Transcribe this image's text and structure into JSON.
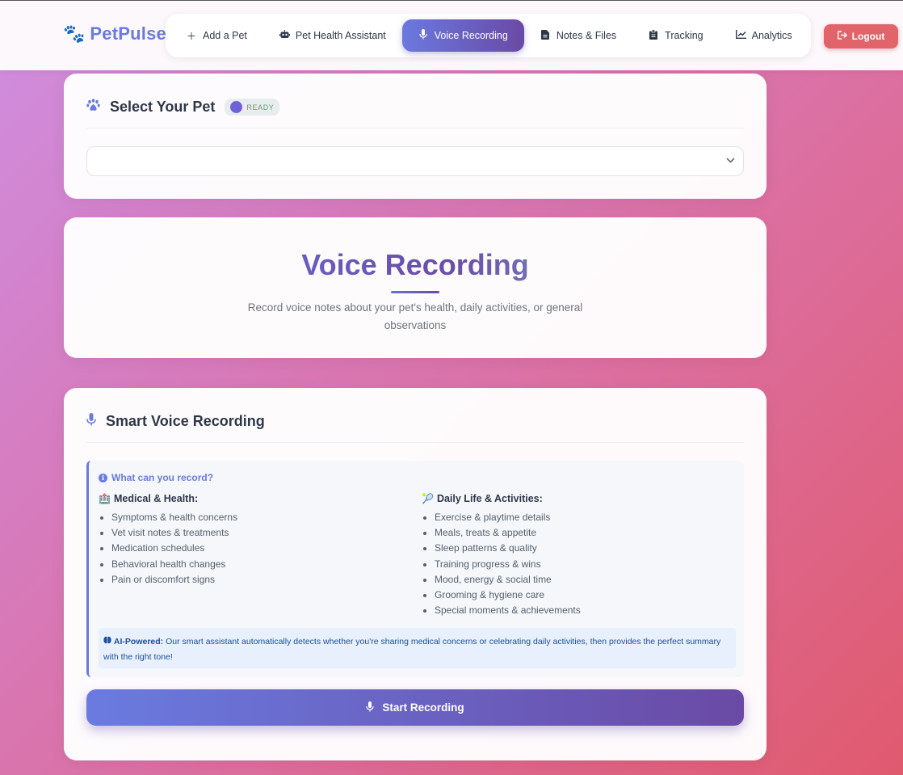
{
  "brand": {
    "logo_icon": "paw-icon",
    "name": "PetPulse"
  },
  "nav": {
    "items": [
      {
        "icon": "plus-icon",
        "label": "Add a Pet",
        "active": false
      },
      {
        "icon": "robot-icon",
        "label": "Pet Health Assistant",
        "active": false
      },
      {
        "icon": "microphone-icon",
        "label": "Voice Recording",
        "active": true
      },
      {
        "icon": "file-icon",
        "label": "Notes & Files",
        "active": false
      },
      {
        "icon": "clipboard-icon",
        "label": "Tracking",
        "active": false
      },
      {
        "icon": "chart-line-icon",
        "label": "Analytics",
        "active": false
      }
    ]
  },
  "logout": {
    "icon": "sign-out-icon",
    "label": "Logout",
    "color": "#e0646a"
  },
  "select_pet": {
    "icon": "paw-icon",
    "title": "Select Your Pet",
    "badge": "READY",
    "dropdown_value": ""
  },
  "hero": {
    "title": "Voice Recording",
    "subtitle": "Record voice notes about your pet's health, daily activities, or general observations"
  },
  "smart": {
    "icon": "microphone-icon",
    "title": "Smart Voice Recording",
    "info_heading": "What can you record?",
    "medical": {
      "emoji": "🏥",
      "heading": "Medical & Health:",
      "items": [
        "Symptoms & health concerns",
        "Vet visit notes & treatments",
        "Medication schedules",
        "Behavioral health changes",
        "Pain or discomfort signs"
      ]
    },
    "daily": {
      "emoji": "🎾",
      "heading": "Daily Life & Activities:",
      "items": [
        "Exercise & playtime details",
        "Meals, treats & appetite",
        "Sleep patterns & quality",
        "Training progress & wins",
        "Mood, energy & social time",
        "Grooming & hygiene care",
        "Special moments & achievements"
      ]
    },
    "ai_label": "AI-Powered:",
    "ai_text": "Our smart assistant automatically detects whether you're sharing medical concerns or celebrating daily activities, then provides the perfect summary with the right tone!",
    "button_label": "Start Recording"
  },
  "colors": {
    "accent": "#6a7be0",
    "accent_dark": "#6a4aa5",
    "ready": "#56a66a"
  }
}
